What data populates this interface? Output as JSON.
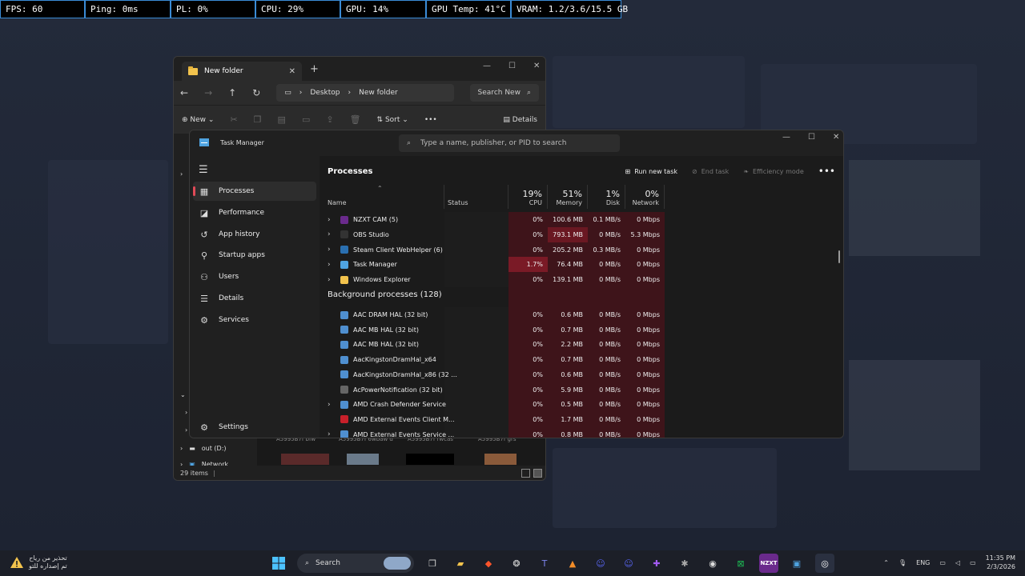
{
  "overlay": {
    "fps": "FPS: 60",
    "ping": "Ping: 0ms",
    "pl": "PL: 0%",
    "cpu": "CPU: 29%",
    "gpu": "GPU: 14%",
    "gpu_temp": "GPU Temp: 41°C",
    "vram": "VRAM: 1.2/3.6/15.5 GB"
  },
  "explorer": {
    "tab_title": "New folder",
    "breadcrumb": [
      "Desktop",
      "New folder"
    ],
    "search_placeholder": "Search New",
    "new_label": "New",
    "sort_label": "Sort",
    "details_label": "Details",
    "drive_label": "out (D:)",
    "network_label": "Network",
    "status": "29 items",
    "thumb_labels": [
      "A5995B7f bfw",
      "A5995B7f 6wbaw d",
      "A5995B7f rwcas",
      "A5995B7f grs"
    ]
  },
  "taskmanager": {
    "title": "Task Manager",
    "search_placeholder": "Type a name, publisher, or PID to search",
    "nav": [
      "Processes",
      "Performance",
      "App history",
      "Startup apps",
      "Users",
      "Details",
      "Services"
    ],
    "settings": "Settings",
    "page_title": "Processes",
    "actions": {
      "run": "Run new task",
      "end": "End task",
      "efficiency": "Efficiency mode"
    },
    "columns": {
      "name": "Name",
      "status": "Status",
      "cpu": {
        "pct": "19%",
        "label": "CPU"
      },
      "memory": {
        "pct": "51%",
        "label": "Memory"
      },
      "disk": {
        "pct": "1%",
        "label": "Disk"
      },
      "network": {
        "pct": "0%",
        "label": "Network"
      }
    },
    "apps": [
      {
        "name": "NZXT CAM (5)",
        "cpu": "0%",
        "mem": "100.6 MB",
        "disk": "0.1 MB/s",
        "net": "0 Mbps",
        "icon": "nzxt",
        "color": "#6a2a8c"
      },
      {
        "name": "OBS Studio",
        "cpu": "0%",
        "mem": "793.1 MB",
        "disk": "0 MB/s",
        "net": "5.3 Mbps",
        "icon": "obs",
        "color": "#333333"
      },
      {
        "name": "Steam Client WebHelper (6)",
        "cpu": "0%",
        "mem": "205.2 MB",
        "disk": "0.3 MB/s",
        "net": "0 Mbps",
        "icon": "steam",
        "color": "#2a6fb0"
      },
      {
        "name": "Task Manager",
        "cpu": "1.7%",
        "mem": "76.4 MB",
        "disk": "0 MB/s",
        "net": "0 Mbps",
        "icon": "taskmgr",
        "color": "#4fa3e0"
      },
      {
        "name": "Windows Explorer",
        "cpu": "0%",
        "mem": "139.1 MB",
        "disk": "0 MB/s",
        "net": "0 Mbps",
        "icon": "folder",
        "color": "#f2c34d"
      }
    ],
    "background_header": "Background processes (128)",
    "background": [
      {
        "name": "AAC DRAM HAL (32 bit)",
        "cpu": "0%",
        "mem": "0.6 MB",
        "disk": "0 MB/s",
        "net": "0 Mbps",
        "expand": false,
        "icon": "app",
        "color": "#4f8fcf"
      },
      {
        "name": "AAC MB HAL (32 bit)",
        "cpu": "0%",
        "mem": "0.7 MB",
        "disk": "0 MB/s",
        "net": "0 Mbps",
        "expand": false,
        "icon": "app",
        "color": "#4f8fcf"
      },
      {
        "name": "AAC MB HAL (32 bit)",
        "cpu": "0%",
        "mem": "2.2 MB",
        "disk": "0 MB/s",
        "net": "0 Mbps",
        "expand": false,
        "icon": "app",
        "color": "#4f8fcf"
      },
      {
        "name": "AacKingstonDramHal_x64",
        "cpu": "0%",
        "mem": "0.7 MB",
        "disk": "0 MB/s",
        "net": "0 Mbps",
        "expand": false,
        "icon": "app",
        "color": "#4f8fcf"
      },
      {
        "name": "AacKingstonDramHal_x86 (32 ...",
        "cpu": "0%",
        "mem": "0.6 MB",
        "disk": "0 MB/s",
        "net": "0 Mbps",
        "expand": false,
        "icon": "app",
        "color": "#4f8fcf"
      },
      {
        "name": "AcPowerNotification (32 bit)",
        "cpu": "0%",
        "mem": "5.9 MB",
        "disk": "0 MB/s",
        "net": "0 Mbps",
        "expand": false,
        "icon": "power",
        "color": "#666666"
      },
      {
        "name": "AMD Crash Defender Service",
        "cpu": "0%",
        "mem": "0.5 MB",
        "disk": "0 MB/s",
        "net": "0 Mbps",
        "expand": true,
        "icon": "app",
        "color": "#4f8fcf"
      },
      {
        "name": "AMD External Events Client M...",
        "cpu": "0%",
        "mem": "1.7 MB",
        "disk": "0 MB/s",
        "net": "0 Mbps",
        "expand": false,
        "icon": "amd",
        "color": "#c8202a"
      },
      {
        "name": "AMD External Events Service ...",
        "cpu": "0%",
        "mem": "0.8 MB",
        "disk": "0 MB/s",
        "net": "0 Mbps",
        "expand": true,
        "icon": "app",
        "color": "#4f8fcf"
      }
    ]
  },
  "taskbar": {
    "widget_line1": "تحذير من رياح",
    "widget_line2": "تم إصداره للتو",
    "search": "Search",
    "lang": "ENG",
    "time": "11:35 PM",
    "date": "2/3/2026"
  }
}
